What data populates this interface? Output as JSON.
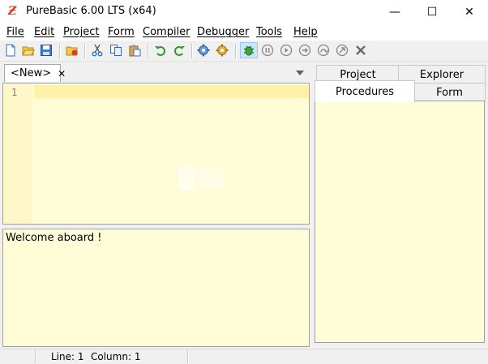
{
  "window": {
    "title": "PureBasic 6.00 LTS (x64)",
    "app_icon": "Ƶ",
    "minimize": "—",
    "maximize": "☐",
    "close": "✕"
  },
  "menu": [
    {
      "label": "File"
    },
    {
      "label": "Edit"
    },
    {
      "label": "Project"
    },
    {
      "label": "Form"
    },
    {
      "label": "Compiler"
    },
    {
      "label": "Debugger"
    },
    {
      "label": "Tools"
    },
    {
      "label": "Help"
    }
  ],
  "toolbar": {
    "icons": [
      "new-file-icon",
      "open-file-icon",
      "save-icon",
      "close-file-icon",
      "cut-icon",
      "copy-icon",
      "paste-icon",
      "undo-icon",
      "redo-icon",
      "compile-run-icon",
      "build-icon",
      "debugger-icon",
      "pause-icon",
      "continue-icon",
      "step-icon",
      "step-over-icon",
      "step-out-icon",
      "kill-program-icon"
    ]
  },
  "editor": {
    "tab_label": "<New>",
    "tab_close": "✕",
    "line_number": "1"
  },
  "output": {
    "text": "Welcome aboard !"
  },
  "right_panel": {
    "tabs": {
      "project": "Project",
      "explorer": "Explorer",
      "procedures": "Procedures",
      "form": "Form"
    },
    "active_tab": "procedures"
  },
  "status": {
    "line": "Line: 1",
    "column": "Column: 1"
  },
  "colors": {
    "editor_bg": "#fffcd8",
    "current_line": "#fff2a8",
    "gutter": "#fff7c8",
    "accent_blue": "#2c6bc4",
    "green": "#2a9a2a"
  }
}
